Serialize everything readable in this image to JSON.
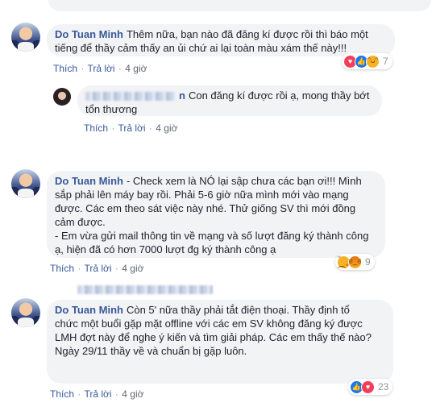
{
  "comments": [
    {
      "author": "Do Tuan Minh",
      "text": "Thêm nữa, bạn nào đã đăng kí được rồi thì báo một\ntiếng để thầy cảm thấy an ủi chứ ai lại toàn màu xám thế này!!!",
      "actions": {
        "like": "Thích",
        "reply": "Trả lời",
        "time": "4 giờ"
      },
      "reactions": {
        "icons": [
          "love-icon",
          "like-icon",
          "haha-icon"
        ],
        "count": "7"
      }
    },
    {
      "author_visible_suffix": "n",
      "text": "Con đăng kí được rồi ạ, mong thầy bớt\ntổn thương",
      "actions": {
        "like": "Thích",
        "reply": "Trả lời",
        "time": "4 giờ"
      }
    },
    {
      "author": "Do Tuan Minh",
      "text": "- Check xem là NÓ lại sập chưa các bạn ơi!!! Mình\nsắp phải lên máy bay rồi. Phải 5-6 giờ nữa mình mới vào mạng\nđược. Các em theo sát việc này nhé. Thử giống SV thì mới đồng\ncảm được.\n- Em vừa gửi mail thông tin về mạng và số lượt đăng ký thành công\nạ, hiện đã có hơn 7000 lượt đg ký thành công ạ",
      "actions": {
        "like": "Thích",
        "reply": "Trả lời",
        "time": "4 giờ"
      },
      "reactions": {
        "icons": [
          "sad-icon",
          "angry-icon"
        ],
        "count": "9"
      }
    },
    {
      "author": "Do Tuan Minh",
      "text": "Còn 5' nữa thầy phải tắt điện thoại. Thầy định tổ\nchức một buổi gặp mặt offline với các em SV không đăng ký được\nLMH đợt này để nghe ý kiến và tìm giải pháp. Các em thấy thế nào?\nNgày 29/11 thầy về và chuẩn bị gặp luôn.",
      "actions": {
        "like": "Thích",
        "reply": "Trả lời",
        "time": "4 giờ"
      },
      "reactions": {
        "icons": [
          "like-icon",
          "love-icon"
        ],
        "count": "23"
      }
    }
  ],
  "colors": {
    "author": "#385898",
    "bubble": "#f2f3f5",
    "meta": "#606770"
  }
}
